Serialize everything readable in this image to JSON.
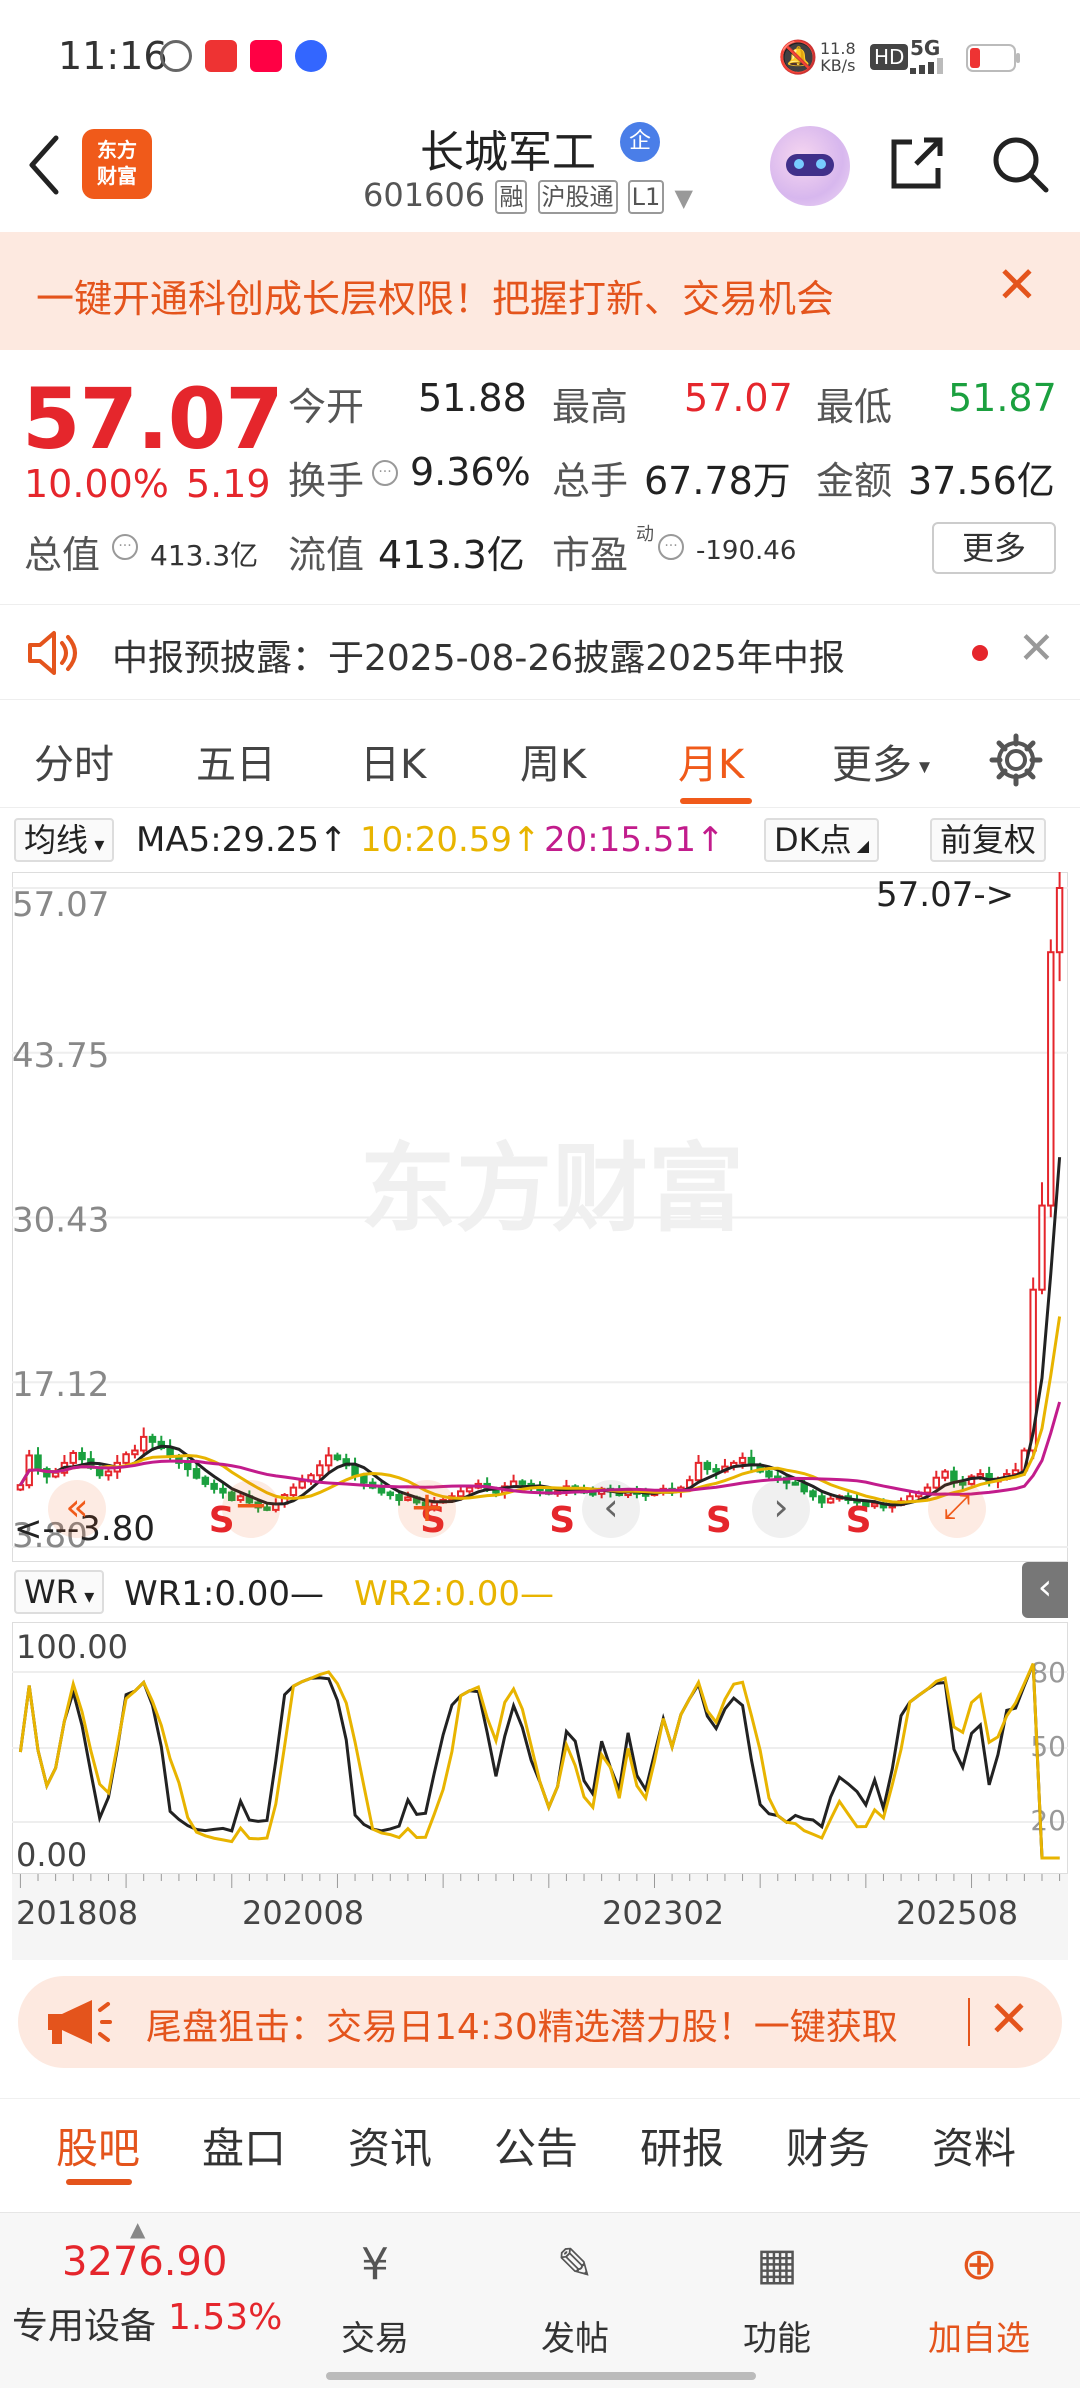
{
  "status_bar": {
    "time": "11:16",
    "net_speed": "11.8",
    "net_unit": "KB/s",
    "hd": "HD",
    "signal": "5G"
  },
  "header": {
    "title": "长城军工",
    "badge": "企",
    "code": "601606",
    "tag1": "融",
    "tag2": "沪股通",
    "tag3": "L1",
    "logo_line1": "东方",
    "logo_line2": "财富"
  },
  "promo": {
    "text": "一键开通科创成长层权限！把握打新、交易机会"
  },
  "quote": {
    "price": "57.07",
    "change_pct": "10.00%",
    "change": "5.19",
    "open_label": "今开",
    "open": "51.88",
    "high_label": "最高",
    "high": "57.07",
    "low_label": "最低",
    "low": "51.87",
    "turnover_label": "换手",
    "turnover": "9.36%",
    "volume_label": "总手",
    "volume": "67.78万",
    "amount_label": "金额",
    "amount": "37.56亿",
    "mcap_label": "总值",
    "mcap": "413.3亿",
    "float_label": "流值",
    "float": "413.3亿",
    "pe_label": "市盈",
    "pe_sup": "动",
    "pe": "-190.46",
    "more": "更多"
  },
  "notice": {
    "text": "中报预披露：于2025-08-26披露2025年中报"
  },
  "tabs": [
    "分时",
    "五日",
    "日K",
    "周K",
    "月K",
    "更多"
  ],
  "active_tab": "月K",
  "ma_row": {
    "btn": "均线",
    "ma5": "MA5:29.25",
    "ma10": "10:20.59",
    "ma20": "20:15.51",
    "dk": "DK点",
    "fq": "前复权",
    "colors": {
      "ma5": "#222222",
      "ma10": "#e8b400",
      "ma20": "#c21c8c"
    }
  },
  "kline": {
    "y_labels": [
      "57.07",
      "43.75",
      "30.43",
      "17.12",
      "3.80"
    ],
    "max_label": "57.07->",
    "min_label": "<---3.80",
    "watermark": "东方财富",
    "signals": [
      "S",
      "S",
      "S",
      "S",
      "S"
    ]
  },
  "wr": {
    "btn": "WR",
    "wr1": "WR1:0.00",
    "wr2": "WR2:0.00",
    "y_left": [
      "100.00",
      "0.00"
    ],
    "y_right": [
      "80",
      "50",
      "20"
    ]
  },
  "x_labels": [
    "201808",
    "202008",
    "202302",
    "202508"
  ],
  "banner2": {
    "text": "尾盘狙击：交易日14:30精选潜力股！一键获取"
  },
  "bottom_tabs": [
    "股吧",
    "盘口",
    "资讯",
    "公告",
    "研报",
    "财务",
    "资料"
  ],
  "nav": {
    "index_value": "3276.90",
    "index_name": "专用设备",
    "index_pct": "1.53%",
    "trade": "交易",
    "post": "发帖",
    "func": "功能",
    "add": "加自选"
  },
  "chart_data": {
    "type": "candlestick",
    "period": "monthly",
    "x_ticks": [
      "201808",
      "202008",
      "202302",
      "202508"
    ],
    "ylim": [
      3.8,
      57.07
    ],
    "closes": [
      8.8,
      11.2,
      10.1,
      9.5,
      9.8,
      10.6,
      11.4,
      10.9,
      10.2,
      9.6,
      9.9,
      10.6,
      11.3,
      11.6,
      12.7,
      12.3,
      11.8,
      11.1,
      10.6,
      10.1,
      9.4,
      8.9,
      8.5,
      8.2,
      7.6,
      7.9,
      7.4,
      7.0,
      6.8,
      7.3,
      8.0,
      8.6,
      9.1,
      9.6,
      10.4,
      11.2,
      10.9,
      10.4,
      9.6,
      9.0,
      8.6,
      8.2,
      8.0,
      7.6,
      7.8,
      7.4,
      7.1,
      7.4,
      7.6,
      7.9,
      8.3,
      8.6,
      8.9,
      8.5,
      8.2,
      8.7,
      9.1,
      8.9,
      8.6,
      8.4,
      8.1,
      8.3,
      8.7,
      8.5,
      8.2,
      8.1,
      8.5,
      8.3,
      8.0,
      8.4,
      8.1,
      8.0,
      8.2,
      8.5,
      8.3,
      8.6,
      9.2,
      10.6,
      10.1,
      9.9,
      10.3,
      10.6,
      11.0,
      10.4,
      9.9,
      9.5,
      9.4,
      9.0,
      8.9,
      8.3,
      7.9,
      7.4,
      7.7,
      7.9,
      7.6,
      7.4,
      7.1,
      7.3,
      7.0,
      7.2,
      7.5,
      7.9,
      8.2,
      8.6,
      9.4,
      9.9,
      9.0,
      8.9,
      9.5,
      9.7,
      9.1,
      9.3,
      9.7,
      10.0,
      11.6,
      24.6,
      31.4,
      51.88,
      57.07
    ],
    "ma5_last": 29.25,
    "ma10_last": 20.59,
    "ma20_last": 15.51
  }
}
